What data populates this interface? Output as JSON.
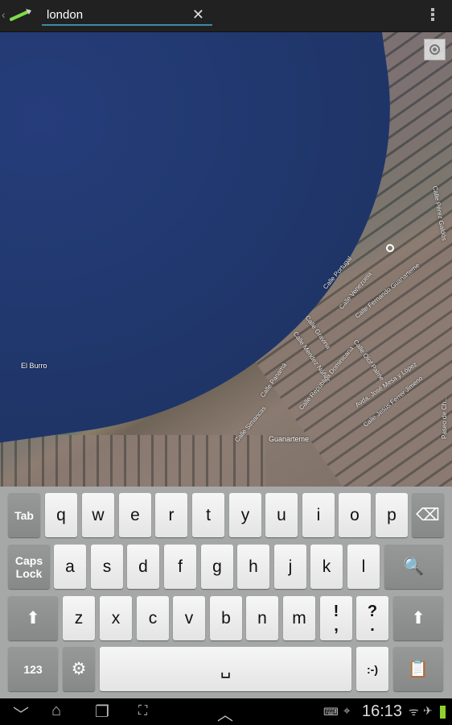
{
  "topbar": {
    "search_value": "london",
    "clear_icon": "close-icon",
    "menu_icon": "overflow-menu-icon"
  },
  "map": {
    "labels": [
      "El Burro",
      "Guanarteme"
    ],
    "streets": [
      "Calle Portugal",
      "Calle Venezuela",
      "Calle Fernando Guanarteme",
      "Calle Gravina",
      "Calle Olof Palme",
      "Calle Mendez Núñez",
      "Calle Panamá",
      "Calle República Dominicana",
      "Avda. José Mesa y López",
      "Calle Jesús Ferrer Jimeno",
      "Calle Simancas",
      "Calle Pérez Galdós",
      "Paseo de Ch..."
    ]
  },
  "keyboard": {
    "row1": [
      "Tab",
      "q",
      "w",
      "e",
      "r",
      "t",
      "y",
      "u",
      "i",
      "o",
      "p",
      "⌫"
    ],
    "row2": [
      "Caps Lock",
      "a",
      "s",
      "d",
      "f",
      "g",
      "h",
      "j",
      "k",
      "l",
      "🔍"
    ],
    "row3": [
      "⬆",
      "z",
      "x",
      "c",
      "v",
      "b",
      "n",
      "m",
      "!\n,",
      "?\n.",
      "⬆"
    ],
    "row4": [
      "123",
      "⚙",
      "␣",
      ":-)",
      "📋"
    ]
  },
  "statusbar": {
    "time": "16:13"
  },
  "colors": {
    "accent": "#3a8ca8",
    "topbar": "#212121",
    "keyboard_bg": "#a6a8a8"
  }
}
